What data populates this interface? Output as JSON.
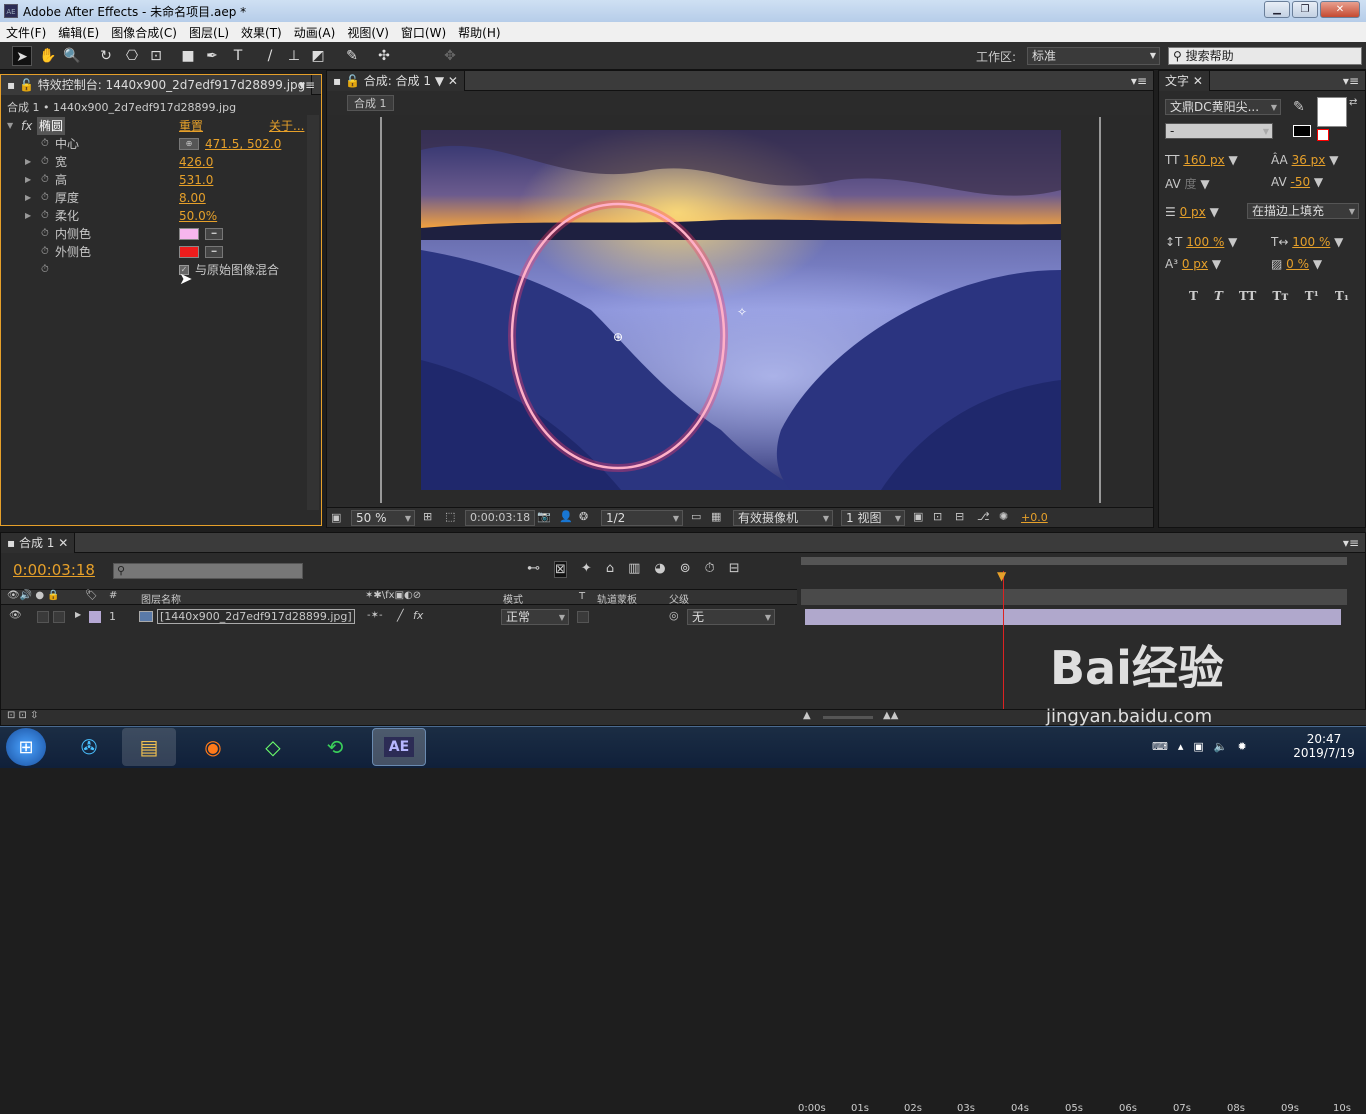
{
  "window": {
    "title": "Adobe After Effects - 未命名项目.aep *",
    "app_icon": "AE"
  },
  "menu": [
    "文件(F)",
    "编辑(E)",
    "图像合成(C)",
    "图层(L)",
    "效果(T)",
    "动画(A)",
    "视图(V)",
    "窗口(W)",
    "帮助(H)"
  ],
  "toolbar": {
    "workspace_label": "工作区:",
    "workspace_value": "标准",
    "search_placeholder": "搜索帮助"
  },
  "effects_panel": {
    "tab": "特效控制台: 1440x900_2d7edf917d28899.jpg",
    "header": "合成 1 • 1440x900_2d7edf917d28899.jpg",
    "effect_name": "椭圆",
    "reset": "重置",
    "about": "关于...",
    "fx": "fx",
    "props": {
      "center": {
        "label": "中心",
        "value": "471.5, 502.0"
      },
      "width": {
        "label": "宽",
        "value": "426.0"
      },
      "height": {
        "label": "高",
        "value": "531.0"
      },
      "thickness": {
        "label": "厚度",
        "value": "8.00"
      },
      "softness": {
        "label": "柔化",
        "value": "50.0%"
      },
      "inside_color": {
        "label": "内侧色",
        "color": "#f7b6ee"
      },
      "outside_color": {
        "label": "外侧色",
        "color": "#ee1c1c"
      },
      "blend": {
        "label": "与原始图像混合"
      }
    }
  },
  "comp_panel": {
    "tab": "合成: 合成 1",
    "subtab": "合成 1",
    "zoom": "50 %",
    "timecode": "0:00:03:18",
    "resolution": "1/2",
    "camera": "有效摄像机",
    "views": "1 视图",
    "exposure": "+0.0"
  },
  "char_panel": {
    "tab": "文字",
    "font": "文鼎DC黄阳尖...",
    "style": "-",
    "size": "160 px",
    "leading": "36 px",
    "kerning": "度",
    "tracking": "-50",
    "stroke_width": "0 px",
    "stroke_mode": "在描边上填充",
    "vscale": "100 %",
    "hscale": "100 %",
    "baseline": "0 px",
    "tsume": "0 %",
    "styles": [
      "T",
      "T",
      "TT",
      "Tт",
      "T¹",
      "T₁"
    ]
  },
  "timeline": {
    "tab": "合成 1",
    "timecode": "0:00:03:18",
    "col_layer_name": "图层名称",
    "col_mode": "模式",
    "col_t": "T",
    "col_track": "轨道蒙板",
    "col_parent": "父级",
    "layer": {
      "index": "1",
      "name": "[1440x900_2d7edf917d28899.jpg]",
      "mode": "正常",
      "parent": "无"
    },
    "ruler": [
      "0:00s",
      "01s",
      "02s",
      "03s",
      "04s",
      "05s",
      "06s",
      "07s",
      "08s",
      "09s",
      "10s"
    ]
  },
  "watermark": {
    "brand": "Bai经验",
    "url": "jingyan.baidu.com"
  },
  "taskbar": {
    "time": "20:47",
    "date": "2019/7/19",
    "active_app": "AE"
  }
}
